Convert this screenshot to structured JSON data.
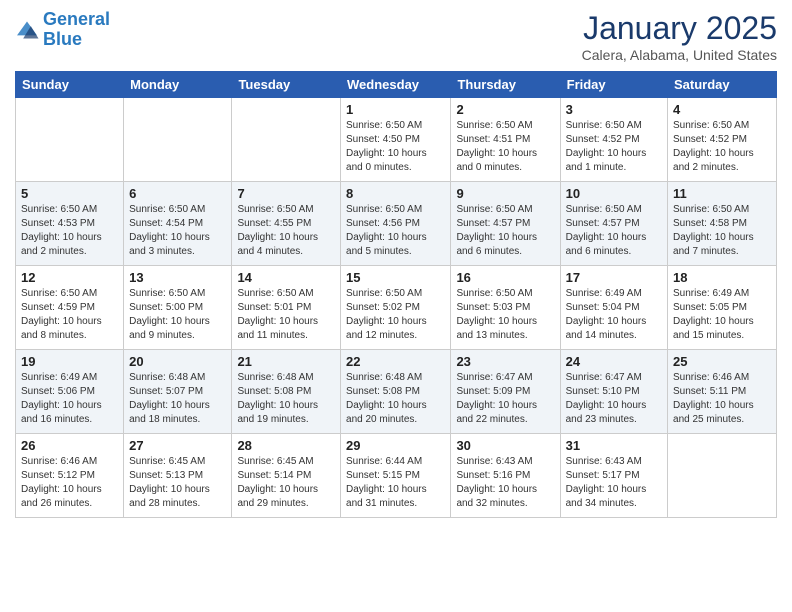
{
  "header": {
    "logo_line1": "General",
    "logo_line2": "Blue",
    "month": "January 2025",
    "location": "Calera, Alabama, United States"
  },
  "weekdays": [
    "Sunday",
    "Monday",
    "Tuesday",
    "Wednesday",
    "Thursday",
    "Friday",
    "Saturday"
  ],
  "weeks": [
    [
      {
        "day": "",
        "sunrise": "",
        "sunset": "",
        "daylight": ""
      },
      {
        "day": "",
        "sunrise": "",
        "sunset": "",
        "daylight": ""
      },
      {
        "day": "",
        "sunrise": "",
        "sunset": "",
        "daylight": ""
      },
      {
        "day": "1",
        "sunrise": "Sunrise: 6:50 AM",
        "sunset": "Sunset: 4:50 PM",
        "daylight": "Daylight: 10 hours and 0 minutes."
      },
      {
        "day": "2",
        "sunrise": "Sunrise: 6:50 AM",
        "sunset": "Sunset: 4:51 PM",
        "daylight": "Daylight: 10 hours and 0 minutes."
      },
      {
        "day": "3",
        "sunrise": "Sunrise: 6:50 AM",
        "sunset": "Sunset: 4:52 PM",
        "daylight": "Daylight: 10 hours and 1 minute."
      },
      {
        "day": "4",
        "sunrise": "Sunrise: 6:50 AM",
        "sunset": "Sunset: 4:52 PM",
        "daylight": "Daylight: 10 hours and 2 minutes."
      }
    ],
    [
      {
        "day": "5",
        "sunrise": "Sunrise: 6:50 AM",
        "sunset": "Sunset: 4:53 PM",
        "daylight": "Daylight: 10 hours and 2 minutes."
      },
      {
        "day": "6",
        "sunrise": "Sunrise: 6:50 AM",
        "sunset": "Sunset: 4:54 PM",
        "daylight": "Daylight: 10 hours and 3 minutes."
      },
      {
        "day": "7",
        "sunrise": "Sunrise: 6:50 AM",
        "sunset": "Sunset: 4:55 PM",
        "daylight": "Daylight: 10 hours and 4 minutes."
      },
      {
        "day": "8",
        "sunrise": "Sunrise: 6:50 AM",
        "sunset": "Sunset: 4:56 PM",
        "daylight": "Daylight: 10 hours and 5 minutes."
      },
      {
        "day": "9",
        "sunrise": "Sunrise: 6:50 AM",
        "sunset": "Sunset: 4:57 PM",
        "daylight": "Daylight: 10 hours and 6 minutes."
      },
      {
        "day": "10",
        "sunrise": "Sunrise: 6:50 AM",
        "sunset": "Sunset: 4:57 PM",
        "daylight": "Daylight: 10 hours and 6 minutes."
      },
      {
        "day": "11",
        "sunrise": "Sunrise: 6:50 AM",
        "sunset": "Sunset: 4:58 PM",
        "daylight": "Daylight: 10 hours and 7 minutes."
      }
    ],
    [
      {
        "day": "12",
        "sunrise": "Sunrise: 6:50 AM",
        "sunset": "Sunset: 4:59 PM",
        "daylight": "Daylight: 10 hours and 8 minutes."
      },
      {
        "day": "13",
        "sunrise": "Sunrise: 6:50 AM",
        "sunset": "Sunset: 5:00 PM",
        "daylight": "Daylight: 10 hours and 9 minutes."
      },
      {
        "day": "14",
        "sunrise": "Sunrise: 6:50 AM",
        "sunset": "Sunset: 5:01 PM",
        "daylight": "Daylight: 10 hours and 11 minutes."
      },
      {
        "day": "15",
        "sunrise": "Sunrise: 6:50 AM",
        "sunset": "Sunset: 5:02 PM",
        "daylight": "Daylight: 10 hours and 12 minutes."
      },
      {
        "day": "16",
        "sunrise": "Sunrise: 6:50 AM",
        "sunset": "Sunset: 5:03 PM",
        "daylight": "Daylight: 10 hours and 13 minutes."
      },
      {
        "day": "17",
        "sunrise": "Sunrise: 6:49 AM",
        "sunset": "Sunset: 5:04 PM",
        "daylight": "Daylight: 10 hours and 14 minutes."
      },
      {
        "day": "18",
        "sunrise": "Sunrise: 6:49 AM",
        "sunset": "Sunset: 5:05 PM",
        "daylight": "Daylight: 10 hours and 15 minutes."
      }
    ],
    [
      {
        "day": "19",
        "sunrise": "Sunrise: 6:49 AM",
        "sunset": "Sunset: 5:06 PM",
        "daylight": "Daylight: 10 hours and 16 minutes."
      },
      {
        "day": "20",
        "sunrise": "Sunrise: 6:48 AM",
        "sunset": "Sunset: 5:07 PM",
        "daylight": "Daylight: 10 hours and 18 minutes."
      },
      {
        "day": "21",
        "sunrise": "Sunrise: 6:48 AM",
        "sunset": "Sunset: 5:08 PM",
        "daylight": "Daylight: 10 hours and 19 minutes."
      },
      {
        "day": "22",
        "sunrise": "Sunrise: 6:48 AM",
        "sunset": "Sunset: 5:08 PM",
        "daylight": "Daylight: 10 hours and 20 minutes."
      },
      {
        "day": "23",
        "sunrise": "Sunrise: 6:47 AM",
        "sunset": "Sunset: 5:09 PM",
        "daylight": "Daylight: 10 hours and 22 minutes."
      },
      {
        "day": "24",
        "sunrise": "Sunrise: 6:47 AM",
        "sunset": "Sunset: 5:10 PM",
        "daylight": "Daylight: 10 hours and 23 minutes."
      },
      {
        "day": "25",
        "sunrise": "Sunrise: 6:46 AM",
        "sunset": "Sunset: 5:11 PM",
        "daylight": "Daylight: 10 hours and 25 minutes."
      }
    ],
    [
      {
        "day": "26",
        "sunrise": "Sunrise: 6:46 AM",
        "sunset": "Sunset: 5:12 PM",
        "daylight": "Daylight: 10 hours and 26 minutes."
      },
      {
        "day": "27",
        "sunrise": "Sunrise: 6:45 AM",
        "sunset": "Sunset: 5:13 PM",
        "daylight": "Daylight: 10 hours and 28 minutes."
      },
      {
        "day": "28",
        "sunrise": "Sunrise: 6:45 AM",
        "sunset": "Sunset: 5:14 PM",
        "daylight": "Daylight: 10 hours and 29 minutes."
      },
      {
        "day": "29",
        "sunrise": "Sunrise: 6:44 AM",
        "sunset": "Sunset: 5:15 PM",
        "daylight": "Daylight: 10 hours and 31 minutes."
      },
      {
        "day": "30",
        "sunrise": "Sunrise: 6:43 AM",
        "sunset": "Sunset: 5:16 PM",
        "daylight": "Daylight: 10 hours and 32 minutes."
      },
      {
        "day": "31",
        "sunrise": "Sunrise: 6:43 AM",
        "sunset": "Sunset: 5:17 PM",
        "daylight": "Daylight: 10 hours and 34 minutes."
      },
      {
        "day": "",
        "sunrise": "",
        "sunset": "",
        "daylight": ""
      }
    ]
  ]
}
